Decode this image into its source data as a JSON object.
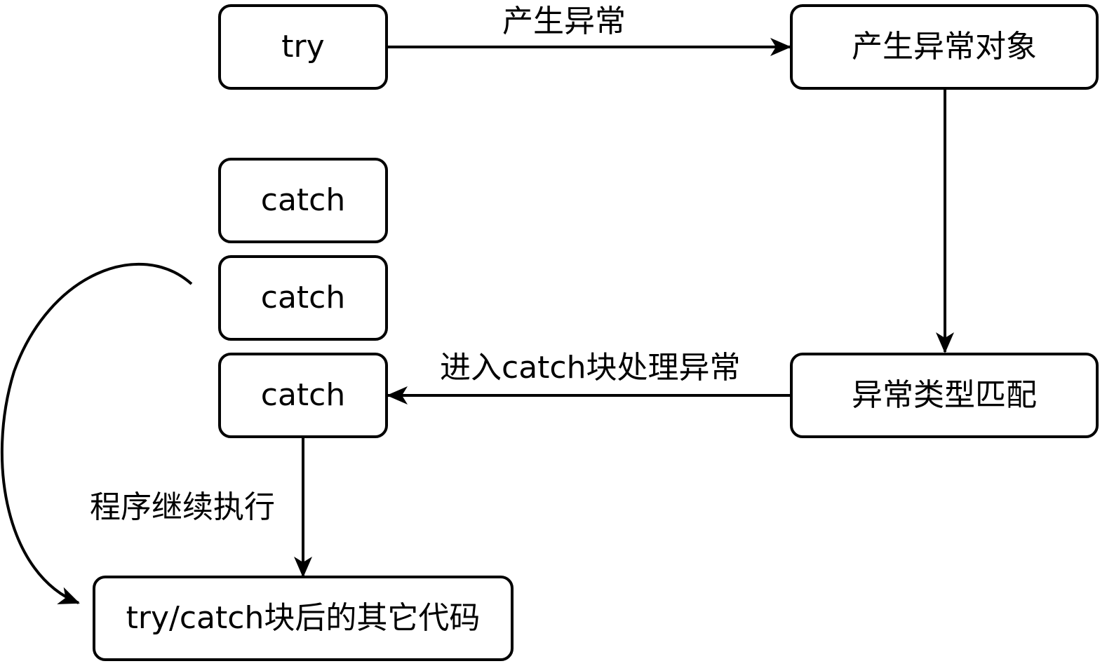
{
  "nodes": {
    "try": "try",
    "exception_object": "产生异常对象",
    "catch_1": "catch",
    "catch_2": "catch",
    "catch_3": "catch",
    "type_match": "异常类型匹配",
    "after_code": "try/catch块后的其它代码"
  },
  "edges": {
    "throw": "产生异常",
    "enter_catch": "进入catch块处理异常",
    "continue": "程序继续执行"
  },
  "colors": {
    "stroke": "#000000",
    "fill": "#ffffff"
  }
}
